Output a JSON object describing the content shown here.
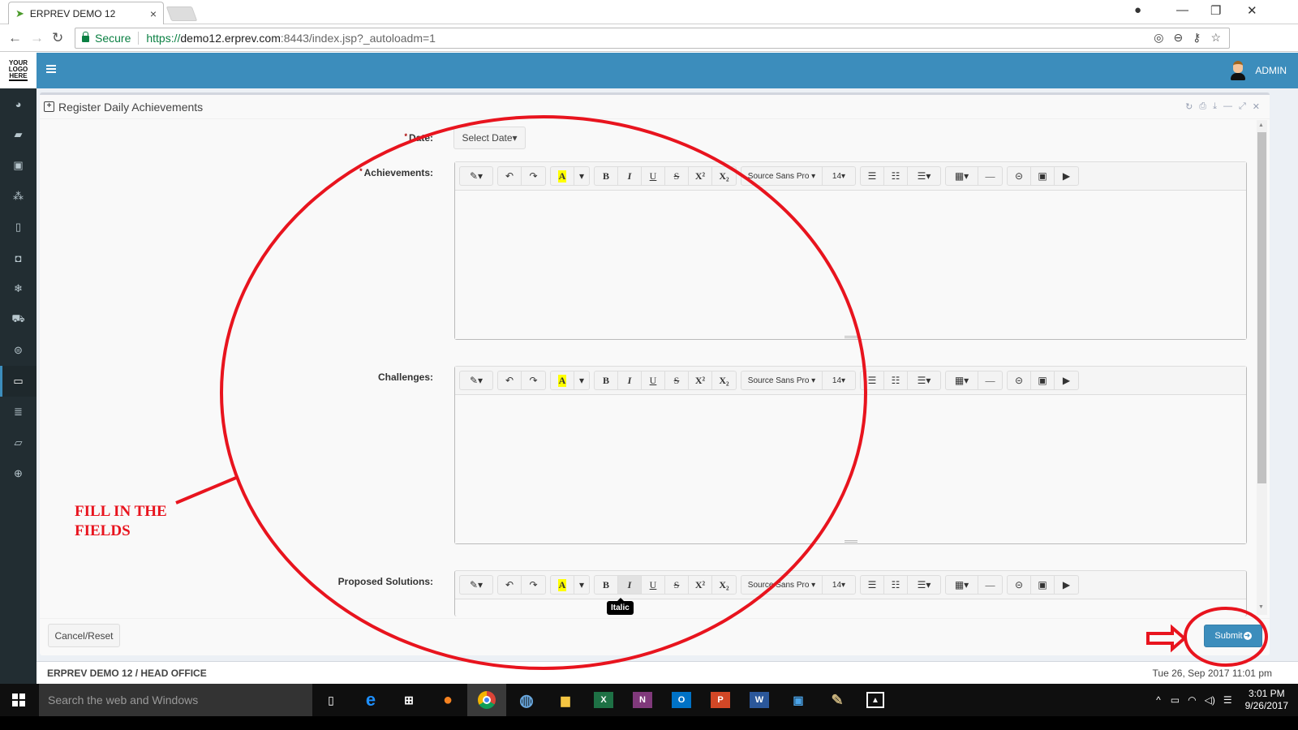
{
  "browser": {
    "tab_title": "ERPREV DEMO 12",
    "tab_close": "×",
    "secure_label": "Secure",
    "url_scheme": "https://",
    "url_host": "demo12.erprev.com",
    "url_rest": ":8443/index.jsp?_autoloadm=1"
  },
  "app": {
    "logo_lines": [
      "YOUR",
      "LOGO",
      "HERE"
    ],
    "user_name": "ADMIN",
    "sidebar_icons": [
      "dashboard-icon",
      "ticket-icon",
      "money-icon",
      "cubes-icon",
      "building-icon",
      "bucket-icon",
      "snowflake-icon",
      "cart-icon",
      "circle-icon",
      "desktop-icon",
      "database-icon",
      "book-icon",
      "support-icon"
    ],
    "sidebar_active_index": 9
  },
  "panel": {
    "title": "Register Daily Achievements",
    "tools": [
      "refresh-icon",
      "print-icon",
      "download-icon",
      "minimize-icon",
      "expand-icon",
      "close-icon"
    ]
  },
  "form": {
    "date_label": "Date:",
    "date_required": "*",
    "date_button": "Select Date▾",
    "editors": [
      {
        "label": "Achievements:",
        "required": true,
        "value": ""
      },
      {
        "label": "Challenges:",
        "required": false,
        "value": ""
      },
      {
        "label": "Proposed Solutions:",
        "required": false,
        "value": ""
      }
    ],
    "toolbar": {
      "style": "✎▾",
      "undo": "↶",
      "redo": "↷",
      "color": "A",
      "color_dropdown": "▾",
      "bold": "B",
      "italic": "I",
      "underline": "U",
      "strike": "S",
      "superscript": "X²",
      "subscript": "X₂",
      "font_name": "Source Sans Pro ▾",
      "font_size": "14▾",
      "ul": "☰",
      "ol": "☷",
      "align": "☰▾",
      "table": "▦▾",
      "hr": "—",
      "link": "⊝",
      "picture": "▣",
      "video": "▶"
    },
    "tooltip": "Italic",
    "cancel_label": "Cancel/Reset",
    "submit_label": "Submit"
  },
  "annotation": {
    "text_line1": "FILL IN THE",
    "text_line2": "FIELDS",
    "color": "#e8141e"
  },
  "status": {
    "company": "ERPREV DEMO 12 / HEAD OFFICE",
    "datetime": "Tue 26, Sep 2017 11:01 pm"
  },
  "taskbar": {
    "search_placeholder": "Search the web and Windows",
    "time": "3:01 PM",
    "date": "9/26/2017",
    "apps": [
      "task-view",
      "edge",
      "store",
      "firefox",
      "chrome",
      "safari",
      "file-explorer",
      "excel",
      "onenote",
      "outlook",
      "powerpoint",
      "word",
      "remote-desktop",
      "paint",
      "photos"
    ]
  },
  "colors": {
    "brand_blue": "#3c8dbc",
    "sidebar": "#222d32",
    "annotation_red": "#e8141e"
  }
}
